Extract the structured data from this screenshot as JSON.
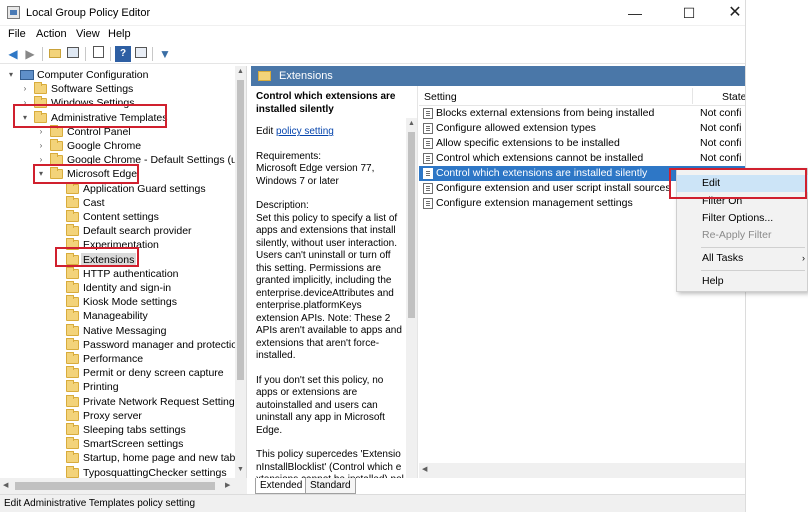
{
  "window": {
    "title": "Local Group Policy Editor",
    "minimize": "—",
    "maximize": "☐",
    "close": "✕"
  },
  "menu": [
    "File",
    "Action",
    "View",
    "Help"
  ],
  "toolbar": {
    "icons": [
      "back-icon",
      "forward-icon",
      "up-folder-icon",
      "show-hide-tree-icon",
      "export-list-icon",
      "help-icon",
      "properties-icon",
      "filter-icon"
    ]
  },
  "tree": {
    "items": [
      {
        "label": "Computer Configuration",
        "level": 0,
        "arrow": "▾",
        "icon": "computer"
      },
      {
        "label": "Software Settings",
        "level": 1,
        "arrow": "›",
        "icon": "folder"
      },
      {
        "label": "Windows Settings",
        "level": 1,
        "arrow": "›",
        "icon": "folder"
      },
      {
        "label": "Administrative Templates",
        "level": 1,
        "arrow": "▾",
        "icon": "folder"
      },
      {
        "label": "Control Panel",
        "level": 2,
        "arrow": "›",
        "icon": "folder"
      },
      {
        "label": "Google Chrome",
        "level": 2,
        "arrow": "›",
        "icon": "folder"
      },
      {
        "label": "Google Chrome - Default Settings (users",
        "level": 2,
        "arrow": "›",
        "icon": "folder"
      },
      {
        "label": "Microsoft Edge",
        "level": 2,
        "arrow": "▾",
        "icon": "folder"
      },
      {
        "label": "Application Guard settings",
        "level": 3,
        "arrow": "",
        "icon": "folder"
      },
      {
        "label": "Cast",
        "level": 3,
        "arrow": "",
        "icon": "folder"
      },
      {
        "label": "Content settings",
        "level": 3,
        "arrow": "",
        "icon": "folder"
      },
      {
        "label": "Default search provider",
        "level": 3,
        "arrow": "",
        "icon": "folder"
      },
      {
        "label": "Experimentation",
        "level": 3,
        "arrow": "",
        "icon": "folder"
      },
      {
        "label": "Extensions",
        "level": 3,
        "arrow": "",
        "icon": "folder",
        "selected": true
      },
      {
        "label": "HTTP authentication",
        "level": 3,
        "arrow": "",
        "icon": "folder"
      },
      {
        "label": "Identity and sign-in",
        "level": 3,
        "arrow": "",
        "icon": "folder"
      },
      {
        "label": "Kiosk Mode settings",
        "level": 3,
        "arrow": "",
        "icon": "folder"
      },
      {
        "label": "Manageability",
        "level": 3,
        "arrow": "",
        "icon": "folder"
      },
      {
        "label": "Native Messaging",
        "level": 3,
        "arrow": "",
        "icon": "folder"
      },
      {
        "label": "Password manager and protection",
        "level": 3,
        "arrow": "",
        "icon": "folder"
      },
      {
        "label": "Performance",
        "level": 3,
        "arrow": "",
        "icon": "folder"
      },
      {
        "label": "Permit or deny screen capture",
        "level": 3,
        "arrow": "",
        "icon": "folder"
      },
      {
        "label": "Printing",
        "level": 3,
        "arrow": "",
        "icon": "folder"
      },
      {
        "label": "Private Network Request Settings",
        "level": 3,
        "arrow": "",
        "icon": "folder"
      },
      {
        "label": "Proxy server",
        "level": 3,
        "arrow": "",
        "icon": "folder"
      },
      {
        "label": "Sleeping tabs settings",
        "level": 3,
        "arrow": "",
        "icon": "folder"
      },
      {
        "label": "SmartScreen settings",
        "level": 3,
        "arrow": "",
        "icon": "folder"
      },
      {
        "label": "Startup, home page and new tab pag",
        "level": 3,
        "arrow": "",
        "icon": "folder"
      },
      {
        "label": "TyposquattingChecker settings",
        "level": 3,
        "arrow": "",
        "icon": "folder"
      }
    ]
  },
  "header": {
    "title": "Extensions"
  },
  "description": {
    "title": "Control which extensions are installed silently",
    "edit_prefix": "Edit ",
    "edit_link": "policy setting",
    "requirements": "Requirements:\nMicrosoft Edge version 77, Windows 7 or later",
    "description": "Description:\nSet this policy to specify a list of apps and extensions that install silently, without user interaction. Users can't uninstall or turn off this setting. Permissions are granted implicitly, including the enterprise.deviceAttributes and enterprise.platformKeys extension APIs. Note: These 2 APIs aren't available to apps and extensions that aren't force-installed.",
    "para2": "If you don't set this policy, no apps or extensions are autoinstalled and users can uninstall any app in Microsoft Edge.",
    "para3": "This policy supercedes 'ExtensionInstallBlocklist' (Control which extensions cannot be installed) policy. If a previously force-installed app or"
  },
  "list": {
    "col_setting": "Setting",
    "col_state": "State",
    "rows": [
      {
        "name": "Blocks external extensions from being installed",
        "state": "Not confi"
      },
      {
        "name": "Configure allowed extension types",
        "state": "Not confi"
      },
      {
        "name": "Allow specific extensions to be installed",
        "state": "Not confi"
      },
      {
        "name": "Control which extensions cannot be installed",
        "state": "Not confi"
      },
      {
        "name": "Control which extensions are installed silently",
        "state": "",
        "active": true
      },
      {
        "name": "Configure extension and user script install sources",
        "state": ""
      },
      {
        "name": "Configure extension management settings",
        "state": ""
      }
    ]
  },
  "context_menu": {
    "items": [
      {
        "label": "Edit",
        "highlight": true
      },
      {
        "label": "Filter On"
      },
      {
        "label": "Filter Options..."
      },
      {
        "label": "Re-Apply Filter",
        "disabled": true
      },
      {
        "label": "All Tasks",
        "submenu": "›"
      },
      {
        "label": "Help"
      }
    ]
  },
  "tabs": [
    "Extended",
    "Standard"
  ],
  "status": "Edit Administrative Templates policy setting",
  "colors": {
    "accent": "#2e77c6",
    "header_band": "#4a77a8",
    "highlight_box": "#d0202e",
    "menu_hover": "#cce4f7"
  }
}
